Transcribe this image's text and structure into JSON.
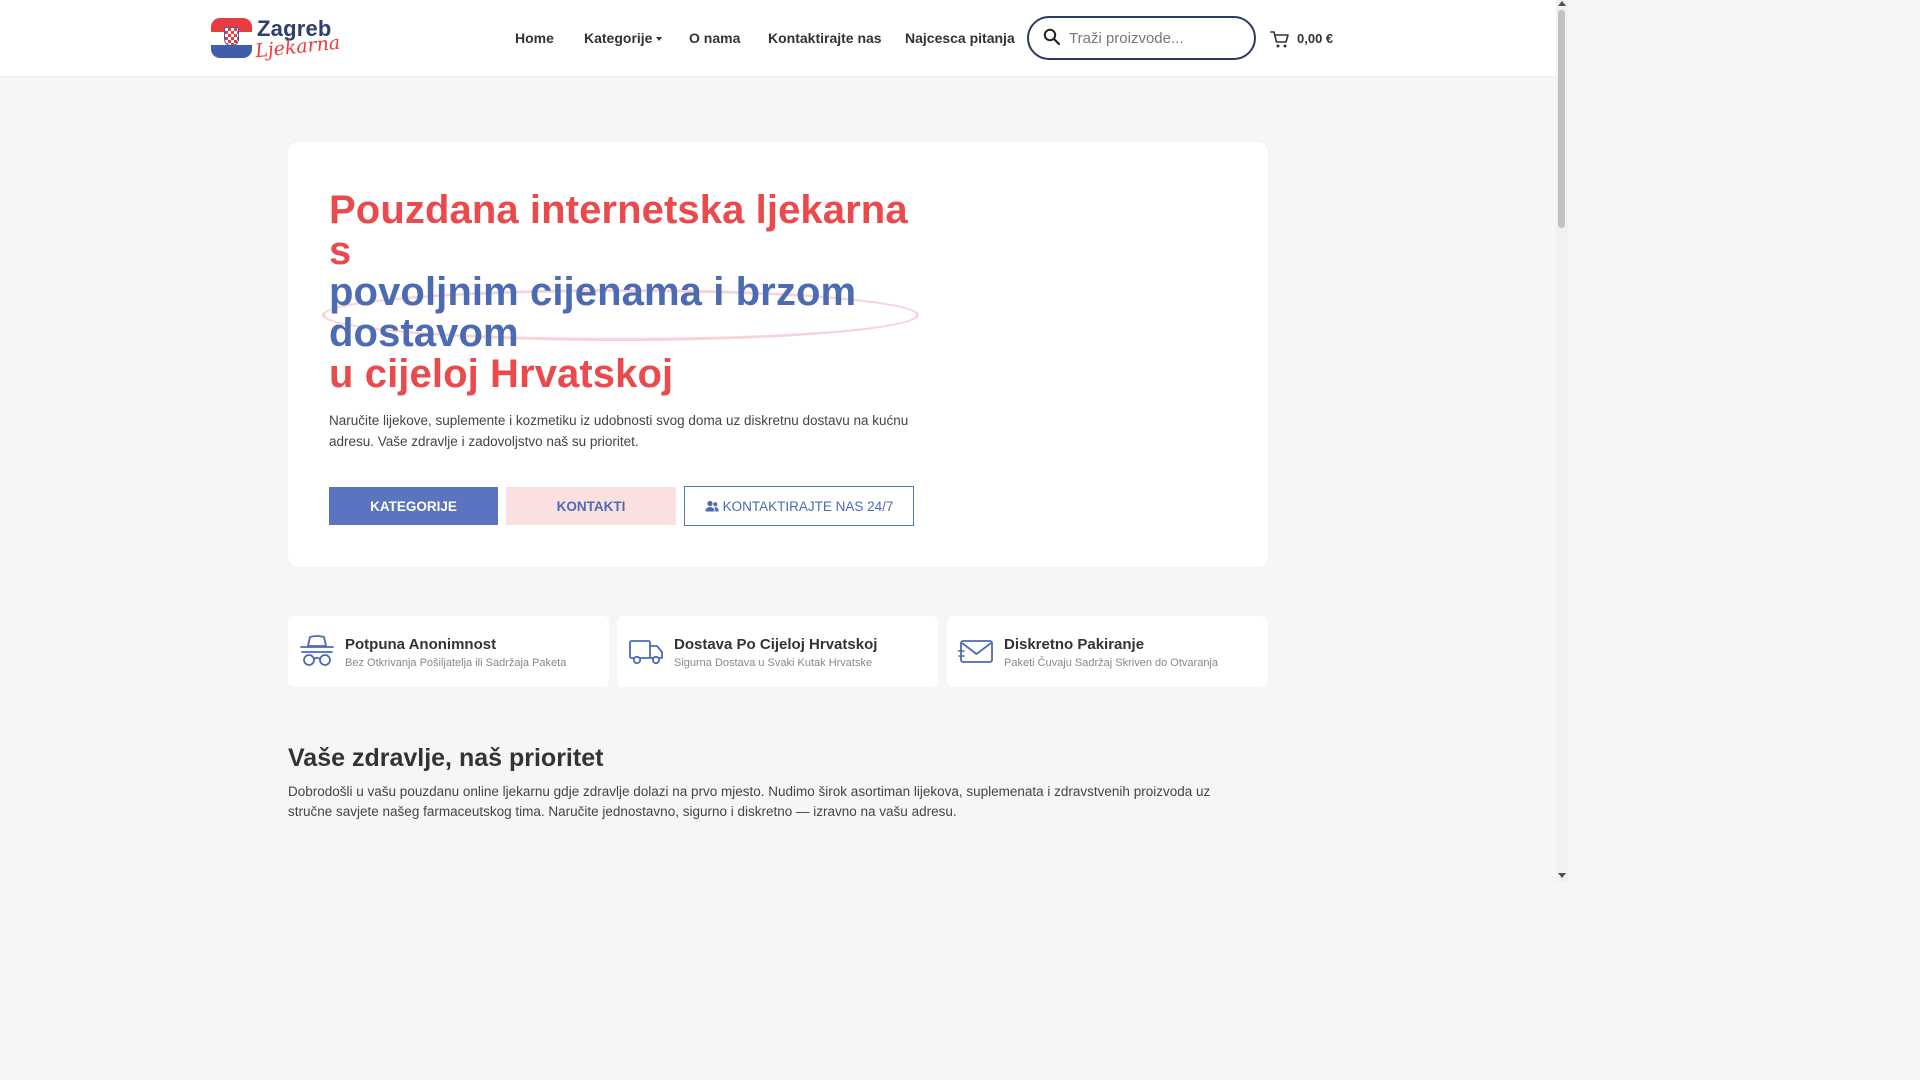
{
  "header": {
    "logo": {
      "word1": "Zagreb",
      "word2": "Ljekarna"
    },
    "nav": [
      {
        "label": "Home"
      },
      {
        "label": "Kategorije"
      },
      {
        "label": "O nama"
      },
      {
        "label": "Kontaktirajte nas"
      },
      {
        "label": "Najcesca pitanja"
      }
    ],
    "search": {
      "placeholder": "Traži proizvode...",
      "value": ""
    },
    "cart": {
      "total": "0,00 €"
    }
  },
  "hero": {
    "title": {
      "line1": "Pouzdana internetska ljekarna",
      "line2": "s",
      "line3": "povoljnim cijenama i brzom",
      "line4": "dostavom",
      "line5": "u cijeloj Hrvatskoj"
    },
    "description": "Naručite lijekove, suplemente i kozmetiku iz udobnosti svog doma uz diskretnu dostavu na kućnu adresu. Vaše zdravlje i zadovoljstvo naš su prioritet.",
    "buttons": {
      "categories": "KATEGORIJE",
      "contacts": "KONTAKTI",
      "contact247": "KONTAKTIRAJTE NAS 24/7"
    }
  },
  "features": [
    {
      "icon": "anonymous-spy-icon",
      "title": "Potpuna Anonimnost",
      "subtitle": "Bez Otkrivanja Pošiljatelja ili Sadržaja Paketa"
    },
    {
      "icon": "delivery-truck-icon",
      "title": "Dostava Po Cijeloj Hrvatskoj",
      "subtitle": "Sigurna Dostava u Svaki Kutak Hrvatske"
    },
    {
      "icon": "envelope-icon",
      "title": "Diskretno Pakiranje",
      "subtitle": "Paketi Čuvaju Sadržaj Skriven do Otvaranja"
    }
  ],
  "section": {
    "title": "Vaše zdravlje, naš prioritet",
    "text": "Dobrodošli u vašu pouzdanu online ljekarnu gdje zdravlje dolazi na prvo mjesto. Nudimo širok asortiman lijekova, suplemenata i zdravstvenih proizvoda uz stručne savjete našeg farmaceutskog tima. Naručite jednostavno, sigurno i diskretno — izravno na vašu adresu."
  },
  "colors": {
    "brand_red": "#ea4a4c",
    "brand_blue": "#4d6bb3",
    "button_blue": "#5b74bf",
    "button_pink": "#fbe0e1",
    "navy": "#2b3a5e"
  }
}
